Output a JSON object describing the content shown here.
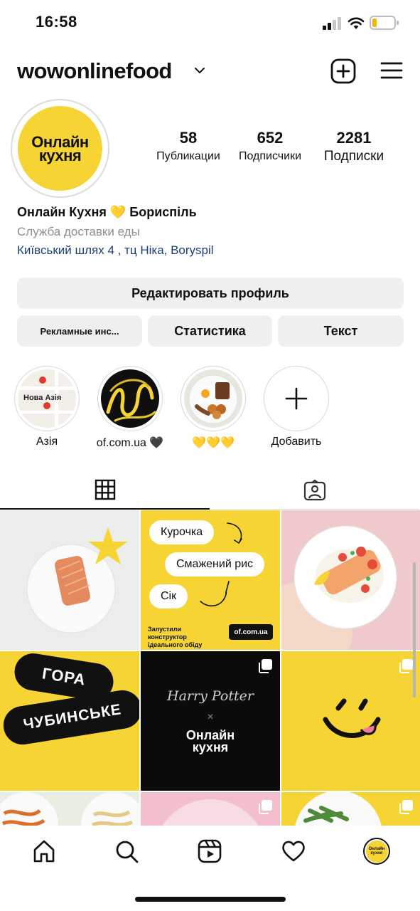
{
  "status_bar": {
    "time": "16:58"
  },
  "header": {
    "username": "wowonlinefood"
  },
  "profile": {
    "avatar_text": "Онлайн\nкухня",
    "stats": [
      {
        "value": "58",
        "label": "Публикации"
      },
      {
        "value": "652",
        "label": "Подписчики"
      },
      {
        "value": "2281",
        "label": "Подписки"
      }
    ],
    "name": "Онлайн Кухня 💛 Бориспіль",
    "category": "Служба доставки еды",
    "location": "Київський шлях 4 , тц Ніка, Boryspil"
  },
  "buttons": {
    "edit_profile": "Редактировать профиль",
    "ads": "Рекламные инс...",
    "statistics": "Статистика",
    "text": "Текст"
  },
  "highlights": [
    {
      "label": "Азія",
      "inner_text": "Нова Азія"
    },
    {
      "label": "of.com.ua 🖤"
    },
    {
      "label": "💛💛💛"
    },
    {
      "label": "Добавить"
    }
  ],
  "posts": {
    "p2": {
      "pills": [
        "Курочка",
        "Смажений рис",
        "Сік"
      ],
      "footer": "Запустили конструктор ідеального обіду",
      "url": "of.com.ua"
    },
    "p4": {
      "line1": "ГОРА",
      "line2": "ЧУБИНСЬКЕ"
    },
    "p5": {
      "top": "Harry Potter",
      "x": "×",
      "brand": "Онлайн\nкухня"
    }
  },
  "colors": {
    "brand_yellow": "#f6d433",
    "link": "#1c3f73"
  },
  "nav": {
    "items": [
      "home-icon",
      "search-icon",
      "reels-icon",
      "heart-icon",
      "profile-avatar"
    ]
  }
}
